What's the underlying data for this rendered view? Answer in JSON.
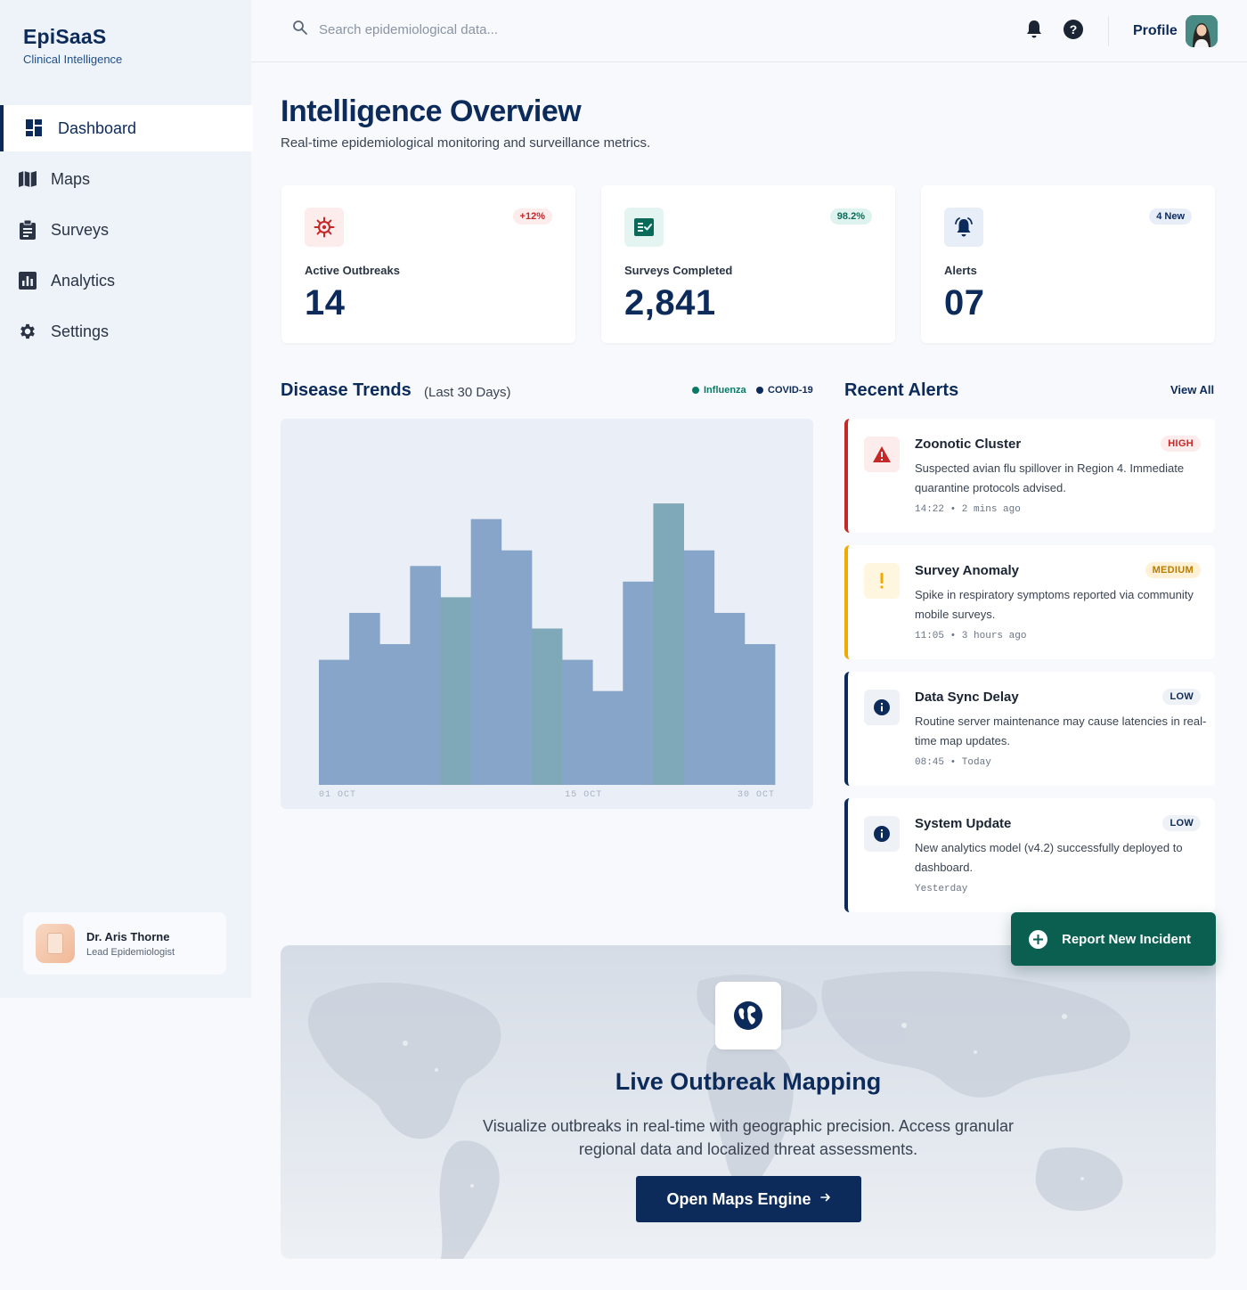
{
  "brand": {
    "name": "EpiSaaS",
    "subtitle": "Clinical Intelligence"
  },
  "sidebar": {
    "items": [
      {
        "label": "Dashboard",
        "icon": "dashboard-icon",
        "active": true
      },
      {
        "label": "Maps",
        "icon": "map-icon"
      },
      {
        "label": "Surveys",
        "icon": "clipboard-icon"
      },
      {
        "label": "Analytics",
        "icon": "analytics-icon"
      },
      {
        "label": "Settings",
        "icon": "gear-icon"
      }
    ],
    "user": {
      "name": "Dr. Aris Thorne",
      "role": "Lead Epidemiologist"
    }
  },
  "topbar": {
    "search_placeholder": "Search epidemiological data...",
    "profile_label": "Profile"
  },
  "header": {
    "title": "Intelligence Overview",
    "subtitle": "Real-time epidemiological monitoring and surveillance metrics."
  },
  "stats": [
    {
      "label": "Active Outbreaks",
      "value": "14",
      "badge": "+12%",
      "icon": "virus-icon",
      "accent": "#c62828"
    },
    {
      "label": "Surveys Completed",
      "value": "2,841",
      "badge": "98.2%",
      "icon": "checklist-icon",
      "accent": "#0a6a5a"
    },
    {
      "label": "Alerts",
      "value": "07",
      "badge": "4 New",
      "icon": "bell-icon",
      "accent": "#0c2a5a"
    }
  ],
  "trends": {
    "title": "Disease Trends",
    "range": "(Last 30 Days)",
    "legend": [
      {
        "name": "Influenza",
        "color": "#0a7a66"
      },
      {
        "name": "COVID-19",
        "color": "#0c2a5a"
      }
    ]
  },
  "chart_data": {
    "type": "bar",
    "categories": [
      "01 OCT",
      "",
      "",
      "",
      "",
      "",
      "",
      "",
      "",
      "15 OCT",
      "",
      "",
      "",
      "",
      "30 OCT"
    ],
    "values": [
      40,
      55,
      45,
      70,
      60,
      85,
      75,
      50,
      40,
      30,
      65,
      90,
      75,
      55,
      45
    ],
    "highlight": [
      false,
      false,
      false,
      false,
      true,
      false,
      false,
      true,
      false,
      false,
      false,
      true,
      false,
      false,
      false
    ],
    "ylim": [
      0,
      100
    ],
    "colors": {
      "bar": "#86a5c9",
      "highlight": "#7fa9b8"
    }
  },
  "alerts": {
    "title": "Recent Alerts",
    "view_all": "View All",
    "items": [
      {
        "title": "Zoonotic Cluster",
        "badge": "HIGH",
        "desc": "Suspected avian flu spillover in Region 4. Immediate quarantine protocols advised.",
        "meta": "14:22 • 2 mins ago",
        "icon": "warning-icon",
        "color": "#c62828"
      },
      {
        "title": "Survey Anomaly",
        "badge": "MEDIUM",
        "desc": "Spike in respiratory symptoms reported via community mobile surveys.",
        "meta": "11:05 • 3 hours ago",
        "icon": "exclamation-icon",
        "color": "#f2a900"
      },
      {
        "title": "Data Sync Delay",
        "badge": "LOW",
        "desc": "Routine server maintenance may cause latencies in real-time map updates.",
        "meta": "08:45 • Today",
        "icon": "info-icon",
        "color": "#0c2a5a"
      },
      {
        "title": "System Update",
        "badge": "LOW",
        "desc": "New analytics model (v4.2) successfully deployed to dashboard.",
        "meta": "Yesterday",
        "icon": "info-icon",
        "color": "#0c2a5a"
      }
    ]
  },
  "report_button": {
    "label": "Report New Incident"
  },
  "map_banner": {
    "title": "Live Outbreak Mapping",
    "description": "Visualize outbreaks in real-time with geographic precision. Access granular regional data and localized threat assessments.",
    "button_label": "Open Maps Engine"
  }
}
